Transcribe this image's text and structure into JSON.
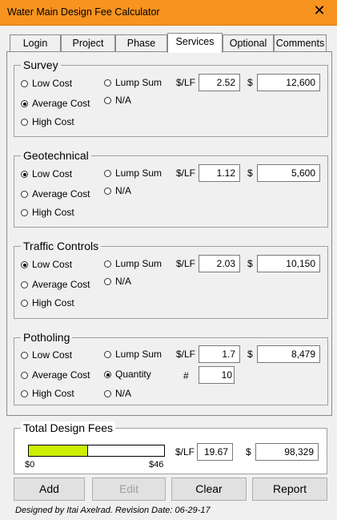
{
  "window": {
    "title": "Water Main Design Fee Calculator",
    "close_glyph": "✕"
  },
  "tabs": [
    "Login",
    "Project",
    "Phase",
    "Services",
    "Optional",
    "Comments"
  ],
  "active_tab": "Services",
  "labels": {
    "per_lf": "$/LF",
    "dollar": "$",
    "hash": "#"
  },
  "radio_labels": {
    "low": "Low Cost",
    "average": "Average Cost",
    "high": "High Cost",
    "lump": "Lump Sum",
    "na": "N/A",
    "quantity": "Quantity"
  },
  "sections": {
    "survey": {
      "title": "Survey",
      "selected": "average",
      "rate": "2.52",
      "amount": "12,600"
    },
    "geotechnical": {
      "title": "Geotechnical",
      "selected": "low",
      "rate": "1.12",
      "amount": "5,600"
    },
    "traffic": {
      "title": "Traffic Controls",
      "selected": "low",
      "rate": "2.03",
      "amount": "10,150"
    },
    "potholing": {
      "title": "Potholing",
      "selected": "quantity",
      "rate": "1.7",
      "amount": "8,479",
      "quantity": "10"
    }
  },
  "total": {
    "title": "Total Design Fees",
    "progress_min_label": "$0",
    "progress_max_label": "$46",
    "progress_fraction": 0.43,
    "rate": "19.67",
    "amount": "98,329",
    "bar_color": "#ccee00"
  },
  "buttons": {
    "add": "Add",
    "edit": "Edit",
    "clear": "Clear",
    "report": "Report"
  },
  "footer": "Designed by Itai Axelrad. Revision Date: 06-29-17",
  "colors": {
    "titlebar": "#f7931e"
  }
}
